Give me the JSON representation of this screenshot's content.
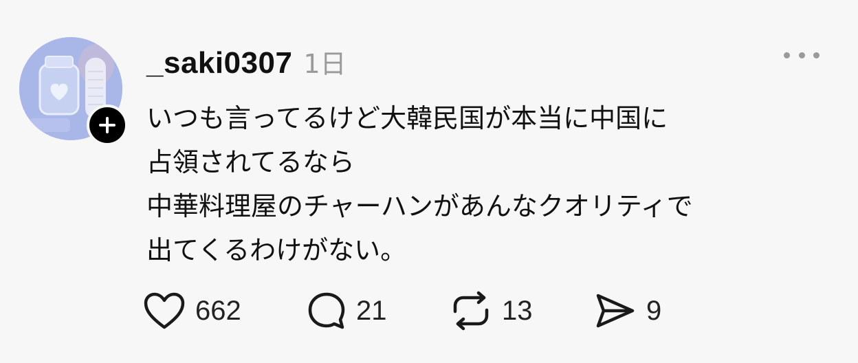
{
  "post": {
    "username": "_saki0307",
    "timestamp": "1日",
    "body_lines": [
      "いつも言ってるけど大韓民国が本当に中国に",
      "占領されてるなら",
      "中華料理屋のチャーハンがあんなクオリティで",
      "出てくるわけがない。"
    ]
  },
  "actions": {
    "like": {
      "icon": "heart-icon",
      "count": "662"
    },
    "reply": {
      "icon": "speech-bubble-icon",
      "count": "21"
    },
    "repost": {
      "icon": "repost-icon",
      "count": "13"
    },
    "share": {
      "icon": "send-icon",
      "count": "9"
    }
  },
  "icons": {
    "more": "more-horizontal-icon",
    "follow": "plus-icon"
  },
  "colors": {
    "background": "#f7f7f7",
    "text": "#111111",
    "muted": "#9a9a9a",
    "badge": "#000000",
    "avatar": "#aebbe9"
  }
}
